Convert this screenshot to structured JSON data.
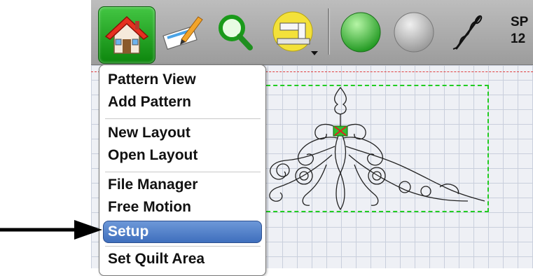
{
  "toolbar": {
    "speed_label_top": "SP",
    "speed_label_bottom": "12",
    "buttons": [
      "home-icon",
      "pencil-ruler-icon",
      "magnifier-icon",
      "sewing-machine-icon",
      "green-circle-icon",
      "gray-circle-icon",
      "needle-thread-icon"
    ],
    "accent": "#22aa22"
  },
  "menu": {
    "items": [
      {
        "label": "Pattern View"
      },
      {
        "label": "Add Pattern"
      },
      {
        "label": "New Layout"
      },
      {
        "label": "Open Layout"
      },
      {
        "label": "File Manager"
      },
      {
        "label": "Free Motion"
      },
      {
        "label": "Setup",
        "selected": true
      },
      {
        "label": "Set Quilt Area"
      }
    ]
  },
  "canvas": {
    "grid_color": "#c9cfdc",
    "quilt_area_color": "#22cc22",
    "limit_line_color": "#e04040"
  }
}
